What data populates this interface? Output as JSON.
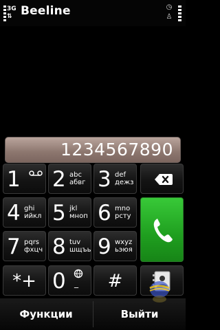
{
  "status_bar": {
    "operator": "Beeline",
    "network": "3G",
    "network_arrows": "⇅",
    "icons": [
      "clock-icon",
      "person-icon"
    ]
  },
  "dialer": {
    "number": "1234567890",
    "keys": [
      {
        "digit": "1",
        "letters_latin": "",
        "letters_cyrillic": "",
        "icon": "voicemail-icon"
      },
      {
        "digit": "2",
        "letters_latin": "abc",
        "letters_cyrillic": "абвг"
      },
      {
        "digit": "3",
        "letters_latin": "def",
        "letters_cyrillic": "дежз"
      },
      {
        "digit": "4",
        "letters_latin": "ghi",
        "letters_cyrillic": "ийкл"
      },
      {
        "digit": "5",
        "letters_latin": "jkl",
        "letters_cyrillic": "мноп"
      },
      {
        "digit": "6",
        "letters_latin": "mno",
        "letters_cyrillic": "рсту"
      },
      {
        "digit": "7",
        "letters_latin": "pqrs",
        "letters_cyrillic": "фхцч"
      },
      {
        "digit": "8",
        "letters_latin": "tuv",
        "letters_cyrillic": "шщъы"
      },
      {
        "digit": "9",
        "letters_latin": "wxyz",
        "letters_cyrillic": "ьэюя"
      },
      {
        "digit": "*+"
      },
      {
        "digit": "0",
        "letters_latin": "_"
      },
      {
        "digit": "#"
      }
    ],
    "backspace_icon": "backspace-icon",
    "call_icon": "phone-call-icon",
    "contacts_icon": "contacts-icon"
  },
  "softkeys": {
    "left": "Функции",
    "right": "Выйти"
  },
  "colors": {
    "call_green": "#2fb82f",
    "display_bg": "#9f8a82",
    "key_bg": "#141414"
  }
}
